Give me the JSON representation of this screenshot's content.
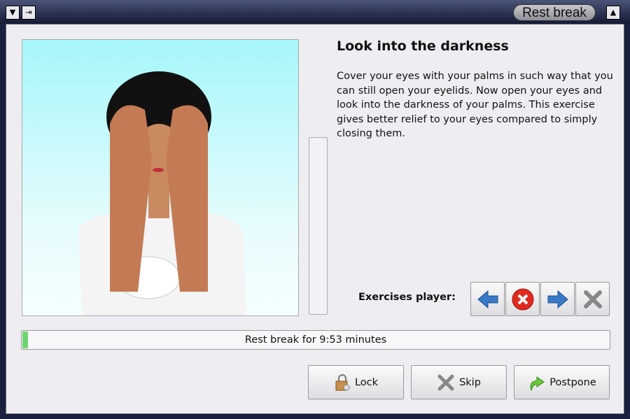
{
  "window": {
    "title": "Rest break",
    "menu_icon": "triangle-down-icon",
    "pin_icon": "pin-icon",
    "maximize_icon": "triangle-up-icon"
  },
  "exercise": {
    "title": "Look into the darkness",
    "description": "Cover your eyes with your palms in such way that you can still open your eyelids. Now open your eyes and look into the darkness of your palms. This exercise gives better relief to your eyes compared to simply closing them."
  },
  "player": {
    "label": "Exercises player:",
    "buttons": [
      "previous",
      "stop",
      "next",
      "close"
    ]
  },
  "progress": {
    "text": "Rest break for 9:53 minutes",
    "percent": 1
  },
  "buttons": {
    "lock": "Lock",
    "skip": "Skip",
    "postpone": "Postpone"
  },
  "colors": {
    "accent_green": "#6ed46e",
    "title_bg": "#141a36"
  }
}
